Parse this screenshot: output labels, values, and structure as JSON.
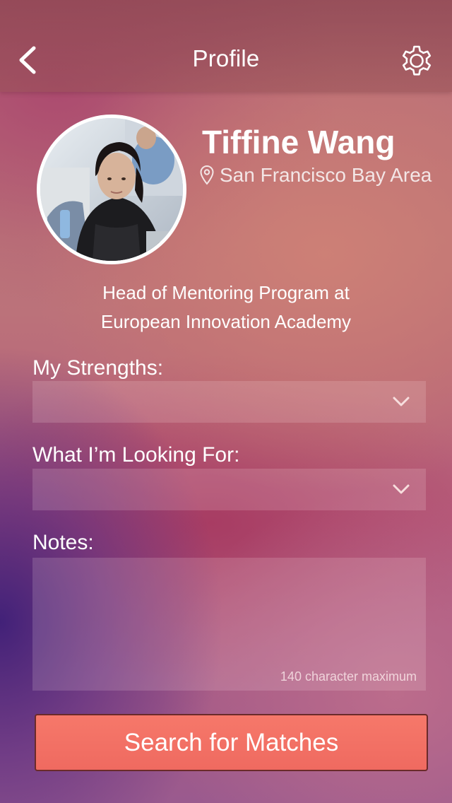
{
  "navbar": {
    "title": "Profile",
    "back_icon": "chevron-left-icon",
    "settings_icon": "gear-icon"
  },
  "profile": {
    "name": "Tiffine Wang",
    "location": "San Francisco Bay Area",
    "location_icon": "map-pin-icon",
    "headline_line1": "Head of Mentoring Program at",
    "headline_line2": "European Innovation Academy"
  },
  "form": {
    "strengths_label": "My Strengths:",
    "strengths_value": "",
    "looking_for_label": "What I’m Looking For:",
    "looking_for_value": "",
    "notes_label": "Notes:",
    "notes_value": "",
    "notes_hint": "140 character maximum"
  },
  "actions": {
    "search_label": "Search for Matches"
  },
  "colors": {
    "button": "#f3705f",
    "text": "#ffffff"
  }
}
